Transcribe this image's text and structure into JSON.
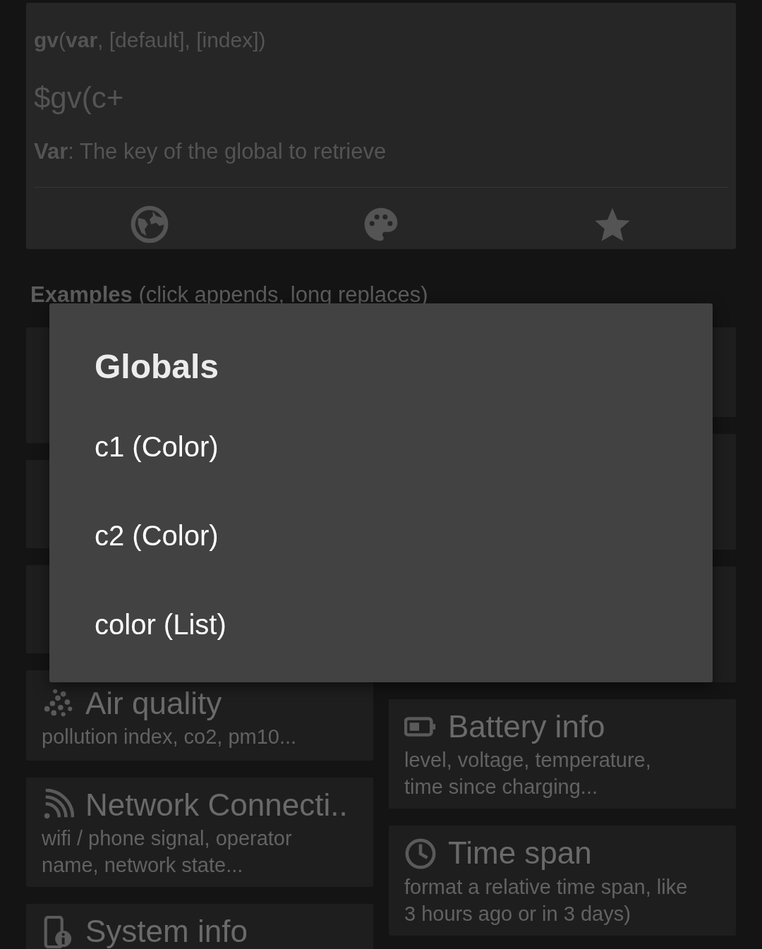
{
  "function_card": {
    "signature": "**gv**(**var**, [default], [index])",
    "expression": "$gv(c+",
    "description": "**Var**: The key of the global to retrieve"
  },
  "examples_heading": "**Examples** (click appends, long replaces)",
  "cards_left": [
    {
      "title": "Air quality",
      "subtitle": "pollution index, co2, pm10..."
    },
    {
      "title": "Network Connecti..",
      "subtitle": "wifi / phone signal, operator name, network state..."
    },
    {
      "title": "System info"
    }
  ],
  "cards_right": [
    {
      "title": "Battery info",
      "subtitle": "level, voltage, temperature, time since charging..."
    },
    {
      "title": "Time span",
      "subtitle": "format a relative time span, like 3 hours ago or in 3 days)"
    }
  ],
  "dialog": {
    "title": "Globals",
    "items": [
      {
        "label": "c1 (Color)"
      },
      {
        "label": "c2 (Color)"
      },
      {
        "label": "color (List)"
      }
    ]
  }
}
